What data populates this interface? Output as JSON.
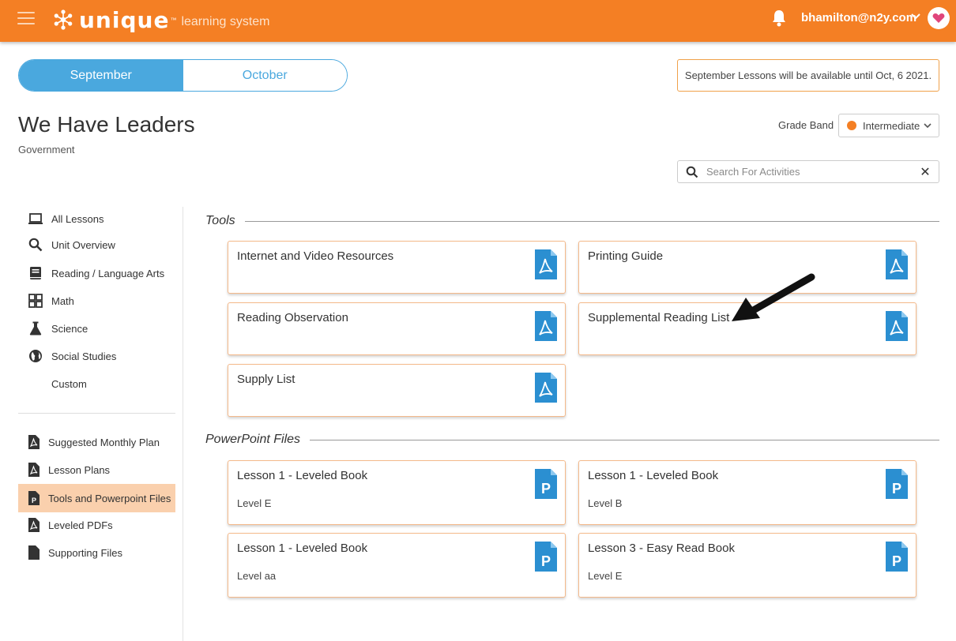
{
  "header": {
    "logo_word": "unique",
    "logo_tm": "™",
    "logo_sub": "learning system",
    "user_email": "bhamilton@n2y.com",
    "accent_color": "#f47f24"
  },
  "months": {
    "active": "September",
    "inactive": "October"
  },
  "notice": "September Lessons will be available until Oct, 6 2021.",
  "page": {
    "title": "We Have Leaders",
    "subtitle": "Government"
  },
  "grade_band": {
    "label": "Grade Band",
    "value": "Intermediate",
    "dot_color": "#f47f24"
  },
  "search": {
    "placeholder": "Search For Activities",
    "value": "",
    "clear": "✕"
  },
  "sidebar": {
    "subjects": [
      {
        "label": "All Lessons",
        "icon": "laptop-icon"
      },
      {
        "label": "Unit Overview",
        "icon": "search-icon"
      },
      {
        "label": "Reading / Language Arts",
        "icon": "book-icon"
      },
      {
        "label": "Math",
        "icon": "calculator-icon"
      },
      {
        "label": "Science",
        "icon": "flask-icon"
      },
      {
        "label": "Social Studies",
        "icon": "globe-icon"
      },
      {
        "label": "Custom",
        "icon": ""
      }
    ],
    "resources": [
      {
        "label": "Suggested Monthly Plan",
        "icon": "pdf-file-icon"
      },
      {
        "label": "Lesson Plans",
        "icon": "pdf-file-icon"
      },
      {
        "label": "Tools and Powerpoint Files",
        "icon": "powerpoint-file-icon",
        "active": true
      },
      {
        "label": "Leveled PDFs",
        "icon": "pdf-file-icon"
      },
      {
        "label": "Supporting Files",
        "icon": "file-icon"
      }
    ]
  },
  "sections": {
    "tools": {
      "heading": "Tools",
      "cards": [
        {
          "title": "Internet and Video Resources",
          "icon": "pdf-icon"
        },
        {
          "title": "Printing Guide",
          "icon": "pdf-icon"
        },
        {
          "title": "Reading Observation",
          "icon": "pdf-icon"
        },
        {
          "title": "Supplemental Reading List",
          "icon": "pdf-icon"
        },
        {
          "title": "Supply List",
          "icon": "pdf-icon"
        }
      ]
    },
    "powerpoint": {
      "heading": "PowerPoint Files",
      "cards": [
        {
          "title": "Lesson 1 - Leveled Book",
          "level": "Level E",
          "icon": "powerpoint-icon"
        },
        {
          "title": "Lesson 1 - Leveled Book",
          "level": "Level B",
          "icon": "powerpoint-icon"
        },
        {
          "title": "Lesson 1 - Leveled Book",
          "level": "Level aa",
          "icon": "powerpoint-icon"
        },
        {
          "title": "Lesson 3 - Easy Read Book",
          "level": "Level E",
          "icon": "powerpoint-icon"
        }
      ]
    }
  },
  "colors": {
    "blue": "#4aa8de",
    "card_border": "#f4b98a",
    "active_side": "#fad0ad"
  }
}
